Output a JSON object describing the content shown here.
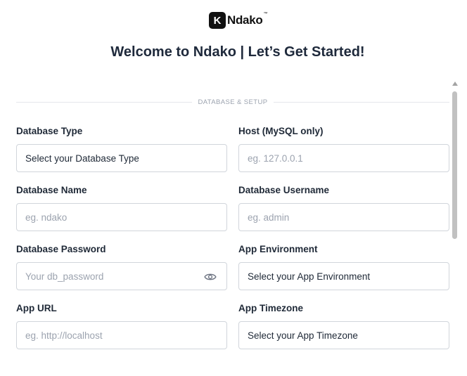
{
  "brand": {
    "logo_letter": "K",
    "name": "Ndako",
    "tm": "™"
  },
  "title": "Welcome to Ndako | Let’s Get Started!",
  "section": "DATABASE & SETUP",
  "fields": {
    "db_type": {
      "label": "Database Type",
      "value": "Select your Database Type"
    },
    "host": {
      "label": "Host (MySQL only)",
      "placeholder": "eg. 127.0.0.1"
    },
    "db_name": {
      "label": "Database Name",
      "placeholder": "eg. ndako"
    },
    "db_user": {
      "label": "Database Username",
      "placeholder": "eg. admin"
    },
    "db_pass": {
      "label": "Database Password",
      "placeholder": "Your db_password",
      "icon": "eye-icon"
    },
    "app_env": {
      "label": "App Environment",
      "value": "Select your App Environment"
    },
    "app_url": {
      "label": "App URL",
      "placeholder": "eg. http://localhost"
    },
    "app_tz": {
      "label": "App Timezone",
      "value": "Select your App Timezone"
    }
  },
  "colors": {
    "text": "#1f2937",
    "placeholder": "#9ca3af",
    "border": "#d1d5db",
    "brand": "#111111"
  }
}
